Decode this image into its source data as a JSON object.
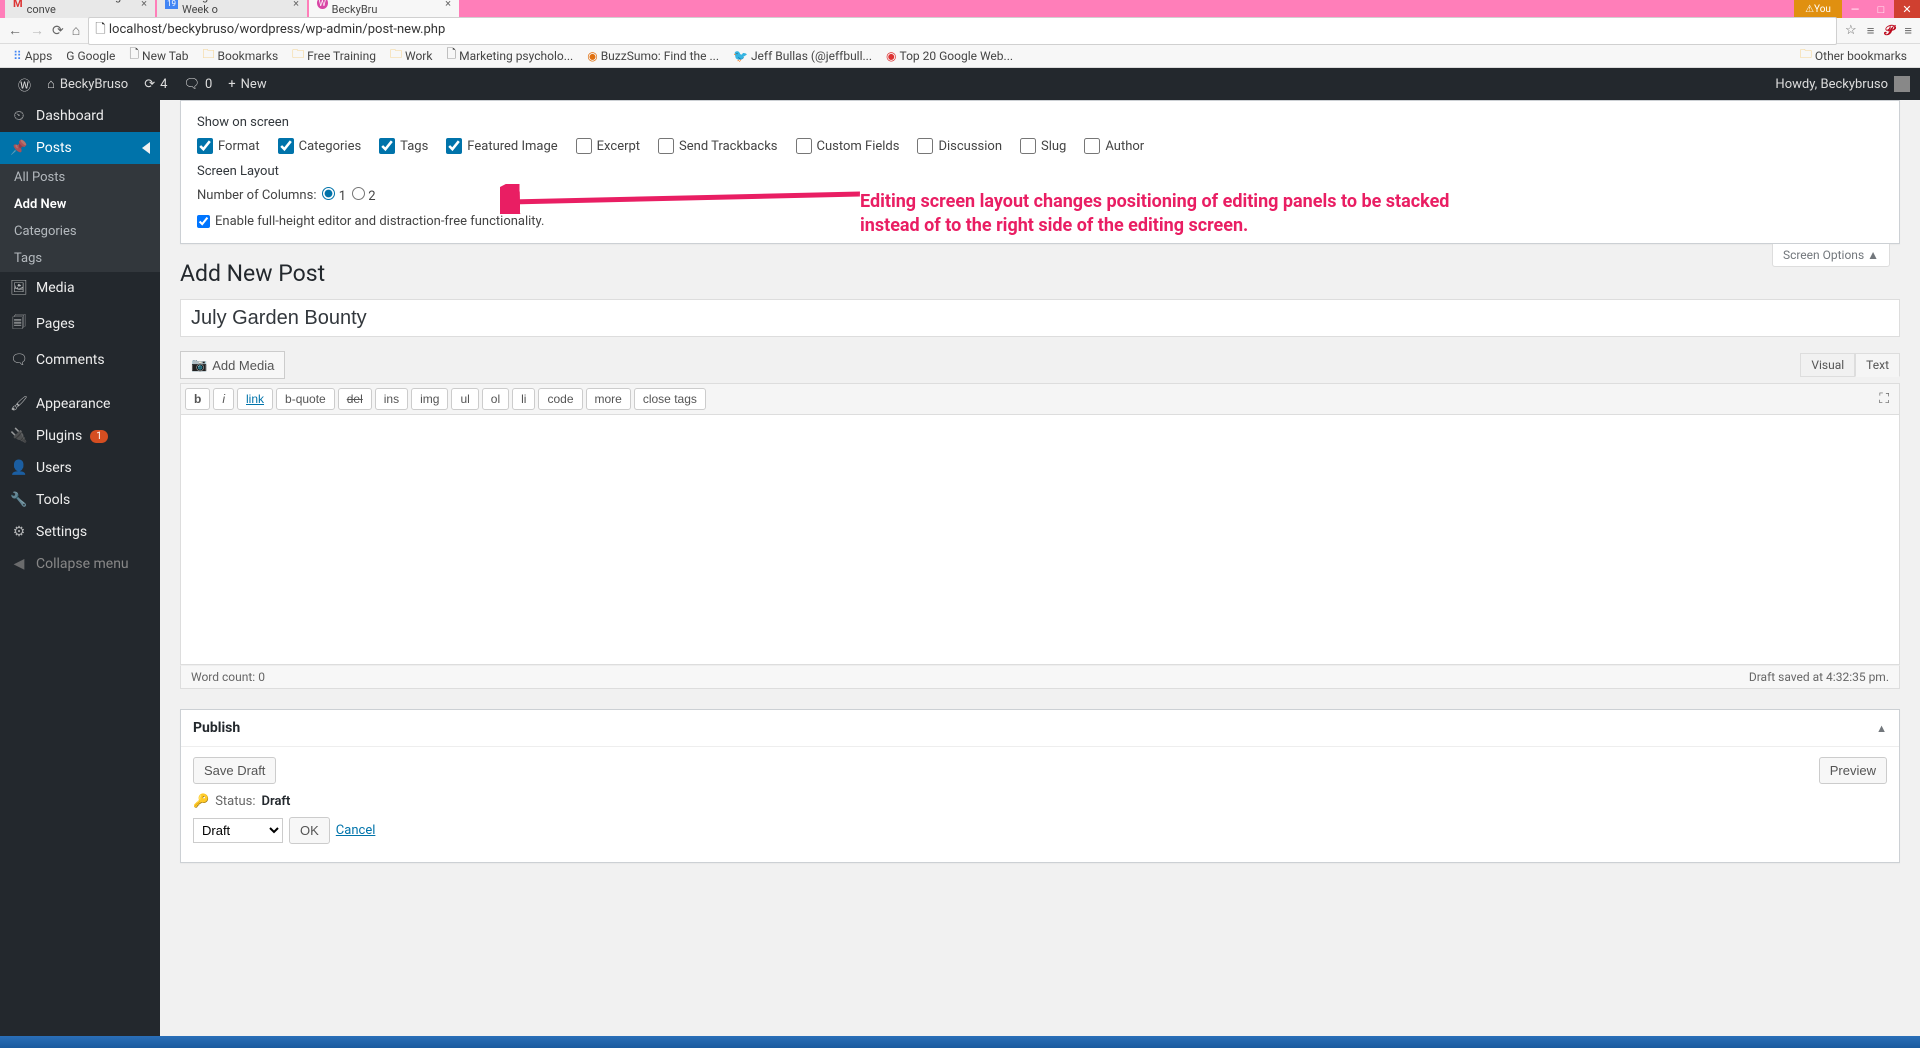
{
  "browser": {
    "tabs": [
      {
        "label": "WordPress Naming conve",
        "icon": "M"
      },
      {
        "label": "Google Calendar - Week o",
        "icon": "19"
      },
      {
        "label": "Add New Post ‹ BeckyBru",
        "icon": "W",
        "active": true
      }
    ],
    "you": "You",
    "url": "localhost/beckybruso/wordpress/wp-admin/post-new.php",
    "bookmarks": {
      "apps": "Apps",
      "google": "Google",
      "newtab": "New Tab",
      "bookmarks": "Bookmarks",
      "freetraining": "Free Training",
      "work": "Work",
      "marketing": "Marketing psycholo...",
      "buzzsumo": "BuzzSumo: Find the ...",
      "jeffbullas": "Jeff Bullas (@jeffbull...",
      "top20": "Top 20 Google Web...",
      "other": "Other bookmarks"
    }
  },
  "wpbar": {
    "site": "BeckyBruso",
    "updates": "4",
    "comments": "0",
    "new": "New",
    "howdy": "Howdy, Beckybruso"
  },
  "sidebar": {
    "dashboard": "Dashboard",
    "posts": "Posts",
    "allposts": "All Posts",
    "addnew": "Add New",
    "categories": "Categories",
    "tags": "Tags",
    "media": "Media",
    "pages": "Pages",
    "comments": "Comments",
    "appearance": "Appearance",
    "plugins": "Plugins",
    "plugins_count": "1",
    "users": "Users",
    "tools": "Tools",
    "settings": "Settings",
    "collapse": "Collapse menu"
  },
  "screenoptions": {
    "showonscreen": "Show on screen",
    "format": "Format",
    "categoriesChk": "Categories",
    "tagsChk": "Tags",
    "featuredimage": "Featured Image",
    "excerpt": "Excerpt",
    "sendtrackbacks": "Send Trackbacks",
    "customfields": "Custom Fields",
    "discussion": "Discussion",
    "slug": "Slug",
    "author": "Author",
    "screenlayout": "Screen Layout",
    "numcols": "Number of Columns:",
    "col1": "1",
    "col2": "2",
    "fullheight": "Enable full-height editor and distraction-free functionality.",
    "tab": "Screen Options"
  },
  "page": {
    "title": "Add New Post",
    "posttitle": "July Garden Bounty",
    "addmedia": "Add Media",
    "visual": "Visual",
    "text": "Text",
    "qt": {
      "b": "b",
      "i": "i",
      "link": "link",
      "bquote": "b-quote",
      "del": "del",
      "ins": "ins",
      "img": "img",
      "ul": "ul",
      "ol": "ol",
      "li": "li",
      "code": "code",
      "more": "more",
      "close": "close tags"
    },
    "wordcount_label": "Word count: ",
    "wordcount": "0",
    "draftsaved": "Draft saved at 4:32:35 pm."
  },
  "publish": {
    "heading": "Publish",
    "savedraft": "Save Draft",
    "preview": "Preview",
    "status_label": "Status:",
    "status_value": "Draft",
    "status_select": "Draft",
    "ok": "OK",
    "cancel": "Cancel"
  },
  "annotation": {
    "line1": "Editing screen layout changes positioning of editing panels to be stacked",
    "line2": "instead of to the right side of the editing screen."
  }
}
